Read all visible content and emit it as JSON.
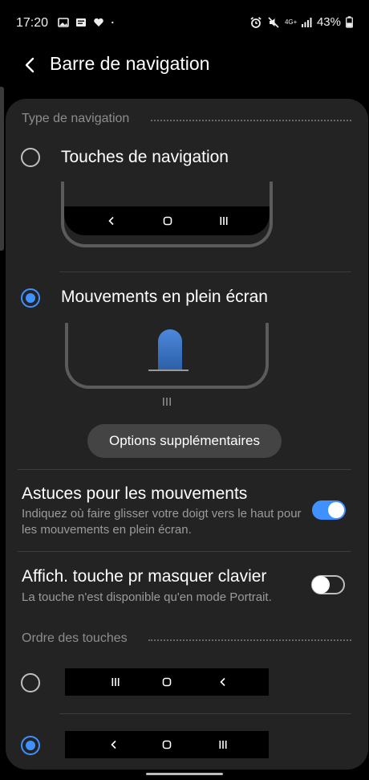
{
  "status_bar": {
    "time": "17:20",
    "battery": "43%",
    "left_icons": [
      "image-icon",
      "message-icon",
      "heart-icon",
      "dot-icon"
    ],
    "right_icons": [
      "alarm-icon",
      "mute-icon",
      "network-4g-icon",
      "signal-icon",
      "battery-icon"
    ],
    "network_label": "4G+"
  },
  "header": {
    "title": "Barre de navigation",
    "back_icon": "chevron-left-icon"
  },
  "navigation_type": {
    "section_title": "Type de navigation",
    "options": [
      {
        "label": "Touches de navigation",
        "selected": false
      },
      {
        "label": "Mouvements en plein écran",
        "selected": true
      }
    ],
    "more_options_button": "Options supplémentaires"
  },
  "gesture_hints": {
    "title": "Astuces pour les mouvements",
    "description": "Indiquez où faire glisser votre doigt vers le haut pour les mouvements en plein écran.",
    "enabled": true
  },
  "hide_keyboard_button": {
    "title": "Affich. touche pr masquer clavier",
    "description": "La touche n'est disponible qu'en mode Portrait.",
    "enabled": false
  },
  "button_order": {
    "section_title": "Ordre des touches",
    "options": [
      {
        "keys": [
          "recents-icon",
          "home-icon",
          "back-icon"
        ],
        "selected": false
      },
      {
        "keys": [
          "back-icon",
          "home-icon",
          "recents-icon"
        ],
        "selected": true
      }
    ]
  },
  "colors": {
    "accent": "#3e91ff",
    "card_background": "#232323",
    "screen_background": "#000000",
    "secondary_text": "#9b9b9b"
  }
}
